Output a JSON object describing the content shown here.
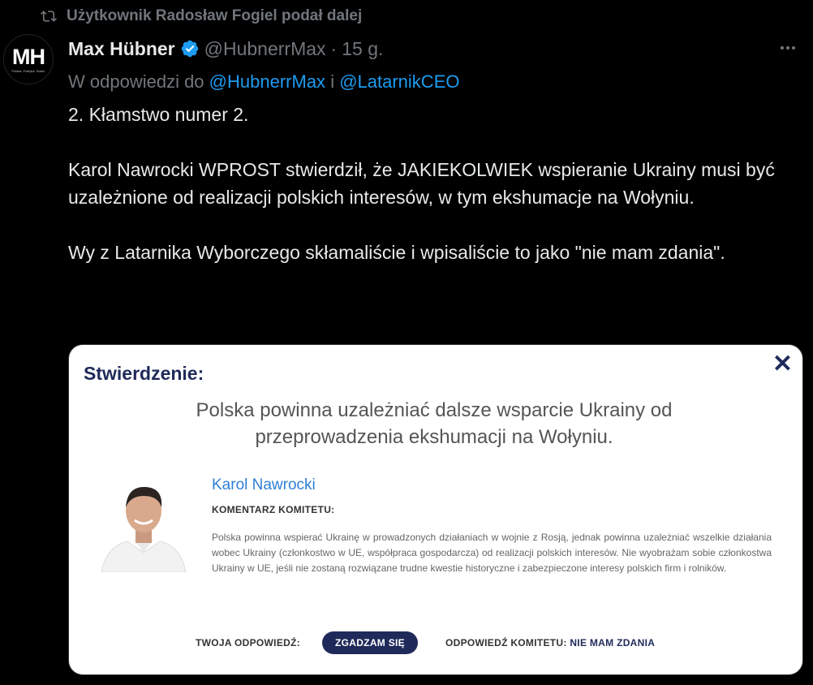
{
  "retweet": {
    "text": "Użytkownik Radosław Fogiel podał dalej"
  },
  "avatar": {
    "initials": "MH",
    "subtext": "Polska. Polityka. Świat."
  },
  "author": {
    "name": "Max Hübner",
    "handle": "@HubnerrMax",
    "separator": "·",
    "time": "15 g."
  },
  "reply": {
    "prefix": "W odpowiedzi do",
    "user1": "@HubnerrMax",
    "conj": "i",
    "user2": "@LatarnikCEO"
  },
  "tweet": {
    "p1": "2. Kłamstwo numer 2.",
    "p2": "Karol Nawrocki WPROST stwierdził, że JAKIEKOLWIEK wspieranie Ukrainy musi być uzależnione od realizacji polskich interesów, w tym ekshumacje na Wołyniu.",
    "p3": "Wy z Latarnika Wyborczego skłamaliście i wpisaliście to jako \"nie mam zdania\"."
  },
  "card": {
    "heading": "Stwierdzenie:",
    "close": "✕",
    "statement": "Polska powinna uzależniać dalsze wsparcie Ukrainy od przeprowadzenia ekshumacji na Wołyniu.",
    "person": "Karol Nawrocki",
    "committee_label": "KOMENTARZ KOMITETU:",
    "comment": "Polska powinna wspierać Ukrainę w prowadzonych działaniach w wojnie z Rosją, jednak powinna uzależniać wszelkie działania wobec Ukrainy (członkostwo w UE, współpraca gospodarcza) od realizacji polskich interesów. Nie wyobrażam sobie członkostwa Ukrainy w UE, jeśli nie zostaną rozwiązane trudne kwestie historyczne i zabezpieczone interesy polskich firm i rolników.",
    "your_answer_label": "TWOJA ODPOWIEDŹ:",
    "your_answer": "ZGADZAM SIĘ",
    "committee_answer_label": "ODPOWIEDŹ KOMITETU:",
    "committee_answer": "NIE MAM ZDANIA"
  },
  "colors": {
    "link": "#1d9bf0",
    "verified": "#1d9bf0",
    "card_navy": "#1f2a5a",
    "person_blue": "#2f7fd6"
  }
}
